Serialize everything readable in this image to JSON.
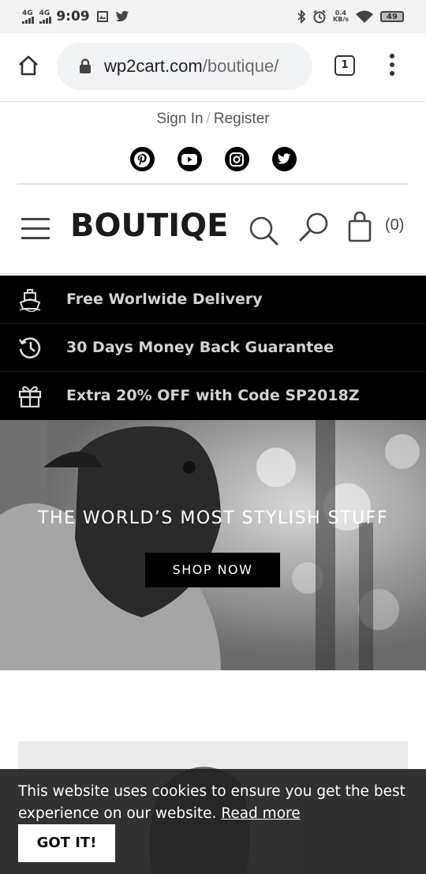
{
  "status_bar": {
    "network_1": "4G",
    "network_2": "4G",
    "time": "9:09",
    "speed_value": "0.4",
    "speed_unit": "KB/s",
    "battery": "49"
  },
  "browser": {
    "url_main": "wp2cart.com",
    "url_path": "/boutique/",
    "tab_count": "1"
  },
  "top_nav": {
    "sign_in": "Sign In",
    "separator": "/",
    "register": "Register"
  },
  "socials": [
    "pinterest-icon",
    "youtube-icon",
    "instagram-icon",
    "twitter-icon"
  ],
  "header": {
    "logo": "BOUTIQE",
    "cart_count": "(0)"
  },
  "promos": [
    {
      "icon": "ship-icon",
      "text": "Free Worlwide Delivery"
    },
    {
      "icon": "history-icon",
      "text": "30 Days Money Back Guarantee"
    },
    {
      "icon": "gift-icon",
      "text": "Extra 20% OFF with Code SP2018Z"
    }
  ],
  "hero": {
    "title": "THE WORLD’S MOST STYLISH STUFF",
    "button": "SHOP NOW"
  },
  "cookie": {
    "message": "This website uses cookies to ensure you get the best experience on our website.",
    "link": "Read more",
    "button": "GOT IT!"
  },
  "colors": {
    "promo_bg": "#000000",
    "promo_text": "#d2d2d2",
    "cookie_bg": "#222222"
  }
}
